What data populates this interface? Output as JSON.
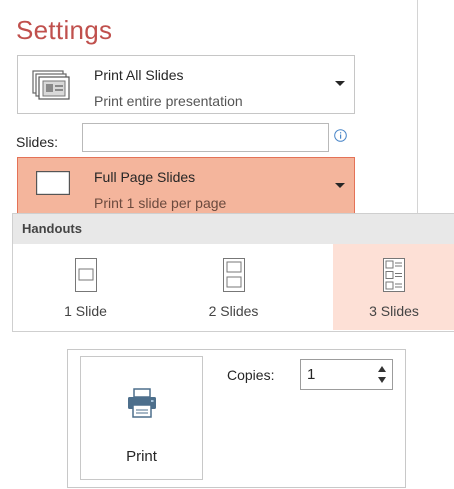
{
  "settings": {
    "title": "Settings"
  },
  "print_range": {
    "title": "Print All Slides",
    "subtitle": "Print entire presentation"
  },
  "slides": {
    "label": "Slides:",
    "value": ""
  },
  "slide_layout": {
    "title": "Full Page Slides",
    "subtitle": "Print 1 slide per page"
  },
  "handouts": {
    "header": "Handouts",
    "options": [
      {
        "label": "1 Slide"
      },
      {
        "label": "2 Slides"
      },
      {
        "label": "3 Slides",
        "selected": true
      }
    ]
  },
  "print": {
    "label": "Print"
  },
  "copies": {
    "label": "Copies:",
    "value": "1"
  },
  "colors": {
    "accent": "#c0504d",
    "selected_fill": "#f4b59c",
    "hover_fill": "#fde0d6"
  }
}
